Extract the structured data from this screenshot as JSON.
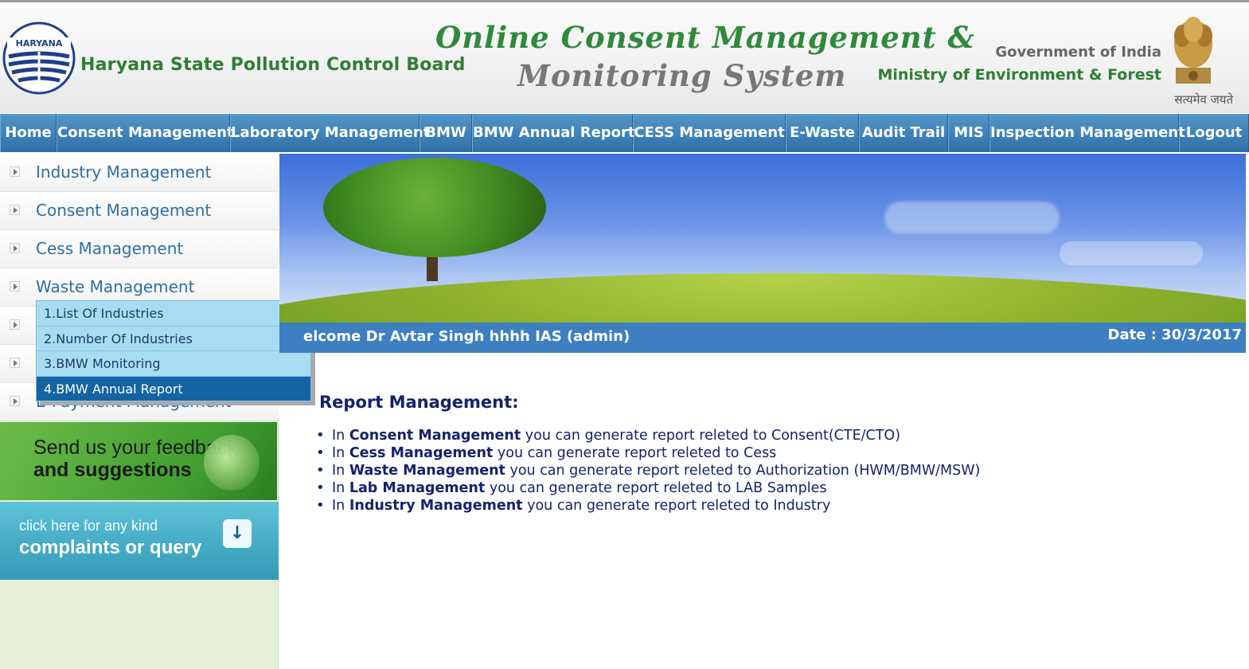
{
  "header": {
    "logo_label": "HARYANA",
    "board_name": "Haryana State Pollution Control Board",
    "system_title_line1": "Online Consent Management &",
    "system_title_line2": "Monitoring System",
    "gov_label": "Government of India",
    "ministry_label": "Ministry of Environment & Forest",
    "emblem_text": "सत्यमेव जयते"
  },
  "nav": {
    "items": [
      {
        "label": "Home"
      },
      {
        "label": "Consent Management"
      },
      {
        "label": "Laboratory Management"
      },
      {
        "label": "BMW"
      },
      {
        "label": "BMW Annual Report"
      },
      {
        "label": "CESS Management"
      },
      {
        "label": "E-Waste"
      },
      {
        "label": "Audit Trail"
      },
      {
        "label": "MIS"
      },
      {
        "label": "Inspection Management"
      },
      {
        "label": "Logout"
      }
    ]
  },
  "sidebar": {
    "items": [
      {
        "label": "Industry Management"
      },
      {
        "label": "Consent Management"
      },
      {
        "label": "Cess Management"
      },
      {
        "label": "Waste Management"
      },
      {
        "label": ""
      },
      {
        "label": ""
      },
      {
        "label": "E-Payment Management"
      }
    ],
    "dropdown": [
      {
        "label": "1.List Of Industries"
      },
      {
        "label": "2.Number Of Industries"
      },
      {
        "label": "3.BMW Monitoring"
      },
      {
        "label": "4.BMW Annual Report"
      }
    ],
    "feedback_line1": "Send us your feedback",
    "feedback_line2": "and suggestions",
    "complaints_line1": "click here for any kind",
    "complaints_line2": "complaints or query",
    "complaints_button": "↓"
  },
  "main": {
    "welcome": "elcome Dr Avtar Singh hhhh IAS (admin)",
    "date": "Date : 30/3/2017",
    "report_title": "Report Management:",
    "report_items": [
      {
        "prefix": "In",
        "bold": "Consent Management",
        "text": "you can generate report releted to Consent(CTE/CTO)"
      },
      {
        "prefix": "In",
        "bold": "Cess Management",
        "text": "you can generate report releted to Cess"
      },
      {
        "prefix": "In",
        "bold": "Waste Management",
        "text": "you can generate report releted to Authorization (HWM/BMW/MSW)"
      },
      {
        "prefix": "In",
        "bold": "Lab Management",
        "text": "you can generate report releted to LAB Samples"
      },
      {
        "prefix": "In",
        "bold": "Industry Management",
        "text": "you can generate report releted to Industry"
      }
    ]
  },
  "colors": {
    "nav_blue": "#3c7fb7",
    "brand_green": "#2e7f33",
    "dropdown_bg": "#a8dcf3",
    "dropdown_active": "#1463a3",
    "report_text": "#13236b"
  }
}
